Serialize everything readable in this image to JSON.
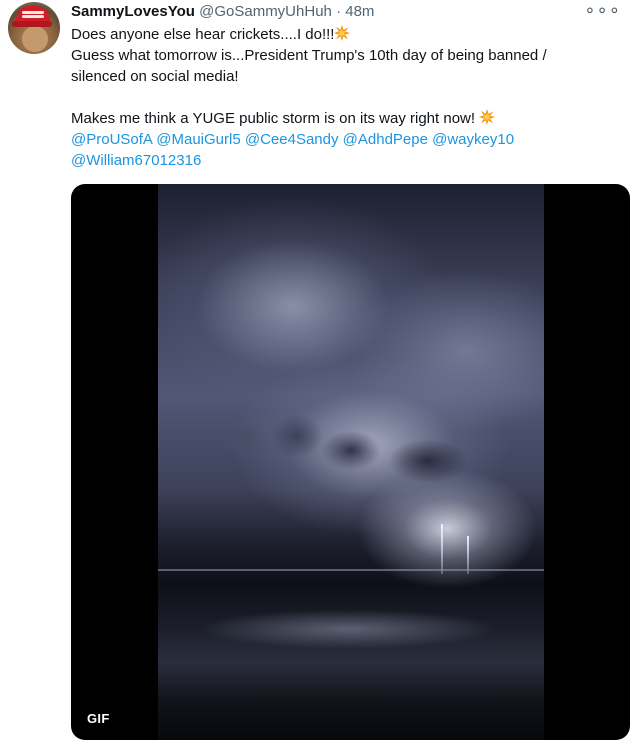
{
  "tweet": {
    "display_name": "SammyLovesYou",
    "handle": "@GoSammyUhHuh",
    "separator": "·",
    "time": "48m",
    "more_glyph": "∘∘∘",
    "line1": "Does anyone else hear crickets....I do!!!",
    "line2": "Guess what tomorrow is...President Trump's 10th day of being banned /",
    "line3": "silenced on social media!",
    "line4": "Makes me think a YUGE public storm is on its way right now!",
    "mentions": [
      "@ProUSofA",
      "@MauiGurl5",
      "@Cee4Sandy",
      "@AdhdPepe",
      "@waykey10",
      "@William67012316"
    ],
    "emoji_icon": "collision-emoji",
    "media": {
      "badge": "GIF",
      "description_icon": "lightning-storm-image"
    }
  },
  "colors": {
    "text": "#0f1419",
    "secondary": "#536471",
    "link": "#1b95e0",
    "media_background": "#000000"
  }
}
